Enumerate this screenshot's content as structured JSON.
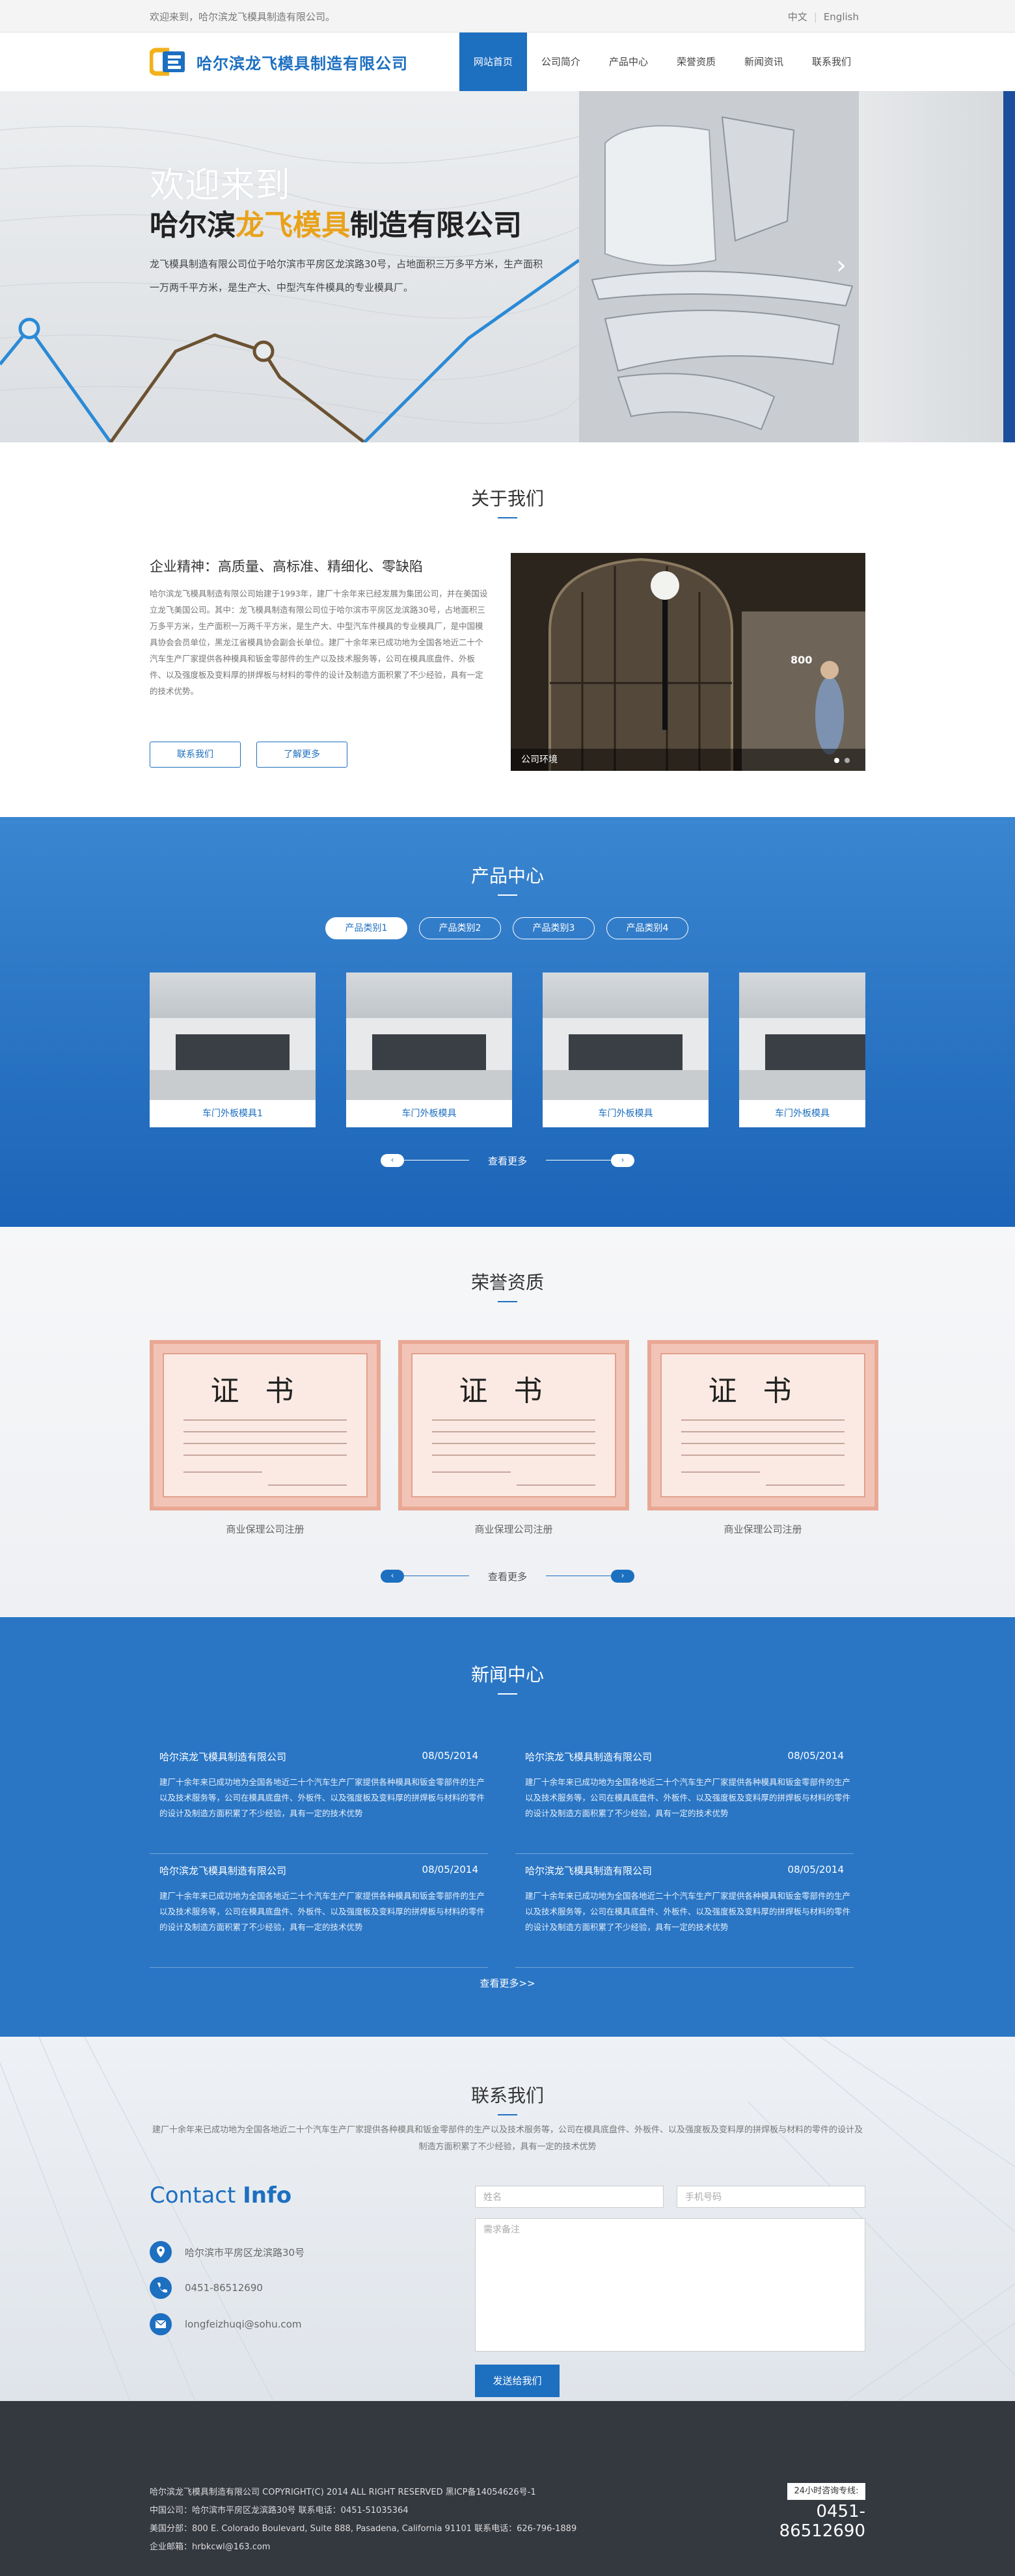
{
  "topbar": {
    "welcome": "欢迎来到，哈尔滨龙飞模具制造有限公司。",
    "lang_cn": "中文",
    "lang_en": "English"
  },
  "header": {
    "logo_text": "哈尔滨龙飞模具制造有限公司",
    "nav": [
      {
        "label": "网站首页",
        "active": true
      },
      {
        "label": "公司简介"
      },
      {
        "label": "产品中心"
      },
      {
        "label": "荣誉资质"
      },
      {
        "label": "新闻资讯"
      },
      {
        "label": "联系我们"
      }
    ]
  },
  "hero": {
    "line1": "欢迎来到",
    "line2_pre": "哈尔滨",
    "line2_highlight": "龙飞模具",
    "line2_post": "制造有限公司",
    "desc": "龙飞模具制造有限公司位于哈尔滨市平房区龙滨路30号，占地面积三万多平方米，生产面积一万两千平方米，是生产大、中型汽车件模具的专业模具厂。"
  },
  "about": {
    "title": "关于我们",
    "spirit": "企业精神：高质量、高标准、精细化、零缺陷",
    "text": "哈尔滨龙飞模具制造有限公司始建于1993年，建厂十余年来已经发展为集团公司，并在美国设立龙飞美国公司。其中：龙飞模具制造有限公司位于哈尔滨市平房区龙滨路30号，占地面积三万多平方米，生产面积一万两千平方米，是生产大、中型汽车件模具的专业模具厂，是中国模具协会会员单位，黑龙江省模具协会副会长单位。建厂十余年来已成功地为全国各地近二十个汽车生产厂家提供各种模具和钣金零部件的生产以及技术服务等，公司在模具底盘件、外板件、以及强度板及变料厚的拼焊板与材料的零件的设计及制造方面积累了不少经验，具有一定的技术优势。",
    "btn_contact": "联系我们",
    "btn_more": "了解更多",
    "image_caption": "公司环境",
    "image_sign": "800"
  },
  "products": {
    "title": "产品中心",
    "tabs": [
      {
        "label": "产品类别1",
        "active": true
      },
      {
        "label": "产品类别2"
      },
      {
        "label": "产品类别3"
      },
      {
        "label": "产品类别4"
      }
    ],
    "items": [
      {
        "name": "车门外板模具1"
      },
      {
        "name": "车门外板模具"
      },
      {
        "name": "车门外板模具"
      },
      {
        "name": "车门外板模具"
      }
    ],
    "more": "查看更多"
  },
  "honors": {
    "title": "荣誉资质",
    "cert_title": "证书",
    "items": [
      {
        "name": "商业保理公司注册"
      },
      {
        "name": "商业保理公司注册"
      },
      {
        "name": "商业保理公司注册"
      }
    ],
    "more": "查看更多"
  },
  "news": {
    "title": "新闻中心",
    "items": [
      {
        "title": "哈尔滨龙飞模具制造有限公司",
        "date": "08/05/2014",
        "body": "建厂十余年来已成功地为全国各地近二十个汽车生产厂家提供各种模具和钣金零部件的生产以及技术服务等，公司在模具底盘件、外板件、以及强度板及变料厚的拼焊板与材料的零件的设计及制造方面积累了不少经验，具有一定的技术优势"
      },
      {
        "title": "哈尔滨龙飞模具制造有限公司",
        "date": "08/05/2014",
        "body": "建厂十余年来已成功地为全国各地近二十个汽车生产厂家提供各种模具和钣金零部件的生产以及技术服务等，公司在模具底盘件、外板件、以及强度板及变料厚的拼焊板与材料的零件的设计及制造方面积累了不少经验，具有一定的技术优势"
      },
      {
        "title": "哈尔滨龙飞模具制造有限公司",
        "date": "08/05/2014",
        "body": "建厂十余年来已成功地为全国各地近二十个汽车生产厂家提供各种模具和钣金零部件的生产以及技术服务等，公司在模具底盘件、外板件、以及强度板及变料厚的拼焊板与材料的零件的设计及制造方面积累了不少经验，具有一定的技术优势"
      },
      {
        "title": "哈尔滨龙飞模具制造有限公司",
        "date": "08/05/2014",
        "body": "建厂十余年来已成功地为全国各地近二十个汽车生产厂家提供各种模具和钣金零部件的生产以及技术服务等，公司在模具底盘件、外板件、以及强度板及变料厚的拼焊板与材料的零件的设计及制造方面积累了不少经验，具有一定的技术优势"
      }
    ],
    "more": "查看更多>>"
  },
  "contact": {
    "title": "联系我们",
    "intro": "建厂十余年来已成功地为全国各地近二十个汽车生产厂家提供各种模具和钣金零部件的生产以及技术服务等，公司在模具底盘件、外板件、以及强度板及变料厚的拼焊板与材料的零件的设计及制造方面积累了不少经验，具有一定的技术优势",
    "heading_light": "Contact",
    "heading_bold": "Info",
    "address": "哈尔滨市平房区龙滨路30号",
    "phone": "0451-86512690",
    "email": "longfeizhuqi@sohu.com",
    "name_placeholder": "姓名",
    "phone_placeholder": "手机号码",
    "note_placeholder": "需求备注",
    "submit": "发送给我们"
  },
  "footer": {
    "line1": "哈尔滨龙飞模具制造有限公司 COPYRIGHT(C) 2014 ALL RIGHT RESERVED 黑ICP备14054626号-1",
    "line2": "中国公司：哈尔滨市平房区龙滨路30号   联系电话：0451-51035364",
    "line3": "美国分部：800 E. Colorado Boulevard, Suite 888, Pasadena, California 91101   联系电话：626-796-1889",
    "line4": "企业邮箱：hrbkcwl@163.com",
    "hotline_label": "24小时咨询专线:",
    "hotline": "0451-86512690"
  },
  "colors": {
    "brand_blue": "#1d6fc0",
    "accent_gold": "#e8a21b",
    "footer_bg": "#34383f"
  }
}
